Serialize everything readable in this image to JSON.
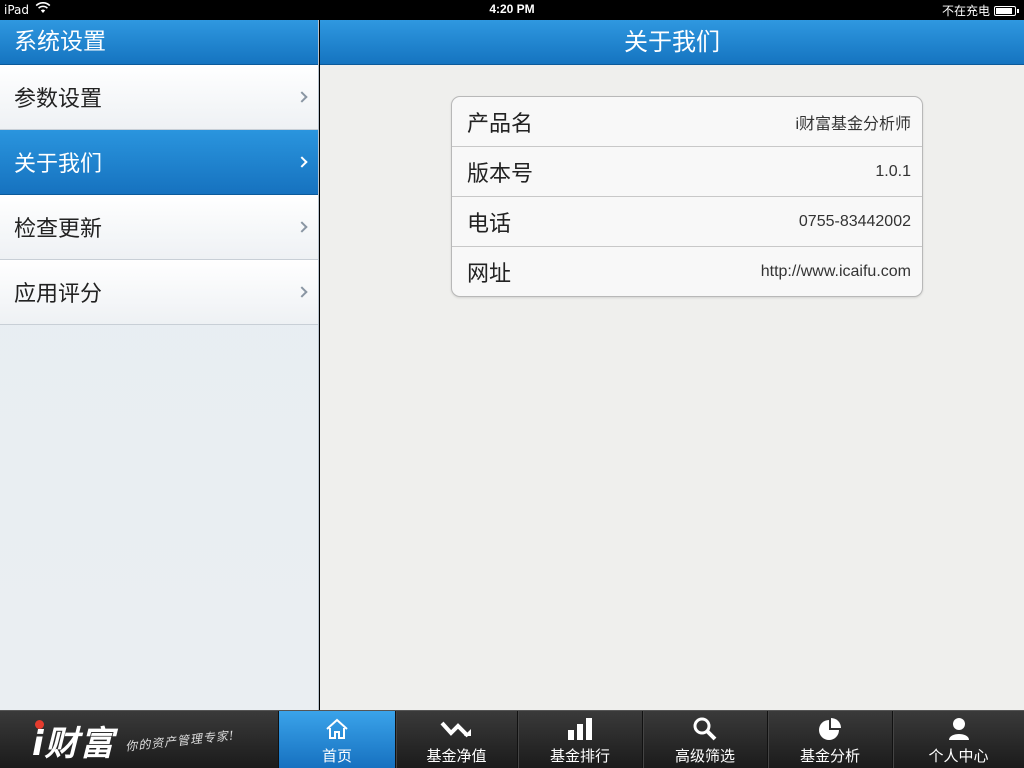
{
  "status_bar": {
    "device": "iPad",
    "time": "4:20 PM",
    "charging_status": "不在充电",
    "battery_level": 0.9
  },
  "sidebar": {
    "title": "系统设置",
    "items": [
      {
        "label": "参数设置",
        "active": false
      },
      {
        "label": "关于我们",
        "active": true
      },
      {
        "label": "检查更新",
        "active": false
      },
      {
        "label": "应用评分",
        "active": false
      }
    ]
  },
  "content": {
    "title": "关于我们",
    "rows": [
      {
        "label": "产品名",
        "value": "i财富基金分析师"
      },
      {
        "label": "版本号",
        "value": "1.0.1"
      },
      {
        "label": "电话",
        "value": "0755-83442002"
      },
      {
        "label": "网址",
        "value": "http://www.icaifu.com"
      }
    ]
  },
  "tabbar": {
    "logo": {
      "letter": "i",
      "text": "财富",
      "slogan": "你的资产管理专家!"
    },
    "tabs": [
      {
        "label": "首页",
        "icon": "home-icon",
        "active": true
      },
      {
        "label": "基金净值",
        "icon": "trend-icon",
        "active": false
      },
      {
        "label": "基金排行",
        "icon": "bar-chart-icon",
        "active": false
      },
      {
        "label": "高级筛选",
        "icon": "search-icon",
        "active": false
      },
      {
        "label": "基金分析",
        "icon": "pie-chart-icon",
        "active": false
      },
      {
        "label": "个人中心",
        "icon": "person-icon",
        "active": false
      }
    ]
  },
  "colors": {
    "accent_blue": "#1e86d2",
    "logo_dot": "#e53c2e"
  }
}
